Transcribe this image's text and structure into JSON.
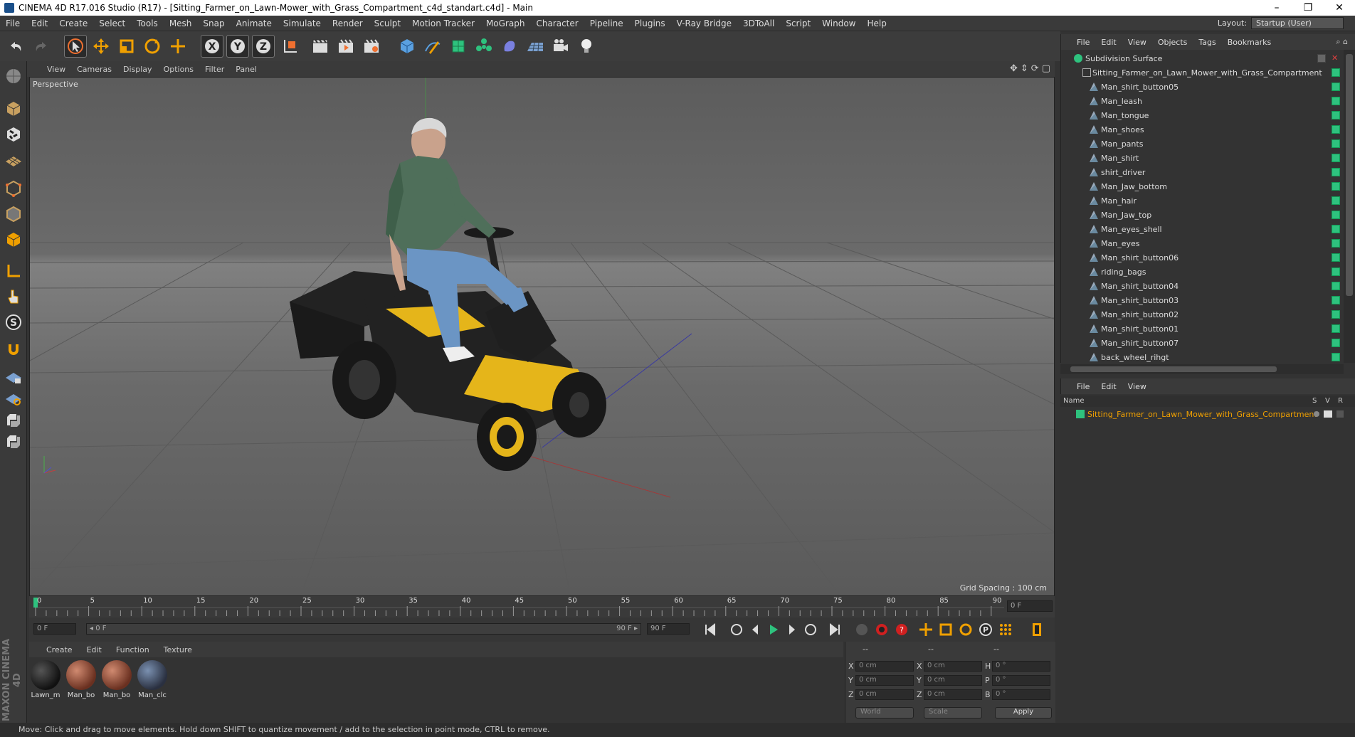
{
  "window": {
    "title": "CINEMA 4D R17.016 Studio (R17) - [Sitting_Farmer_on_Lawn-Mower_with_Grass_Compartment_c4d_standart.c4d] - Main",
    "controls": [
      "–",
      "❐",
      "✕"
    ]
  },
  "menu": [
    "File",
    "Edit",
    "Create",
    "Select",
    "Tools",
    "Mesh",
    "Snap",
    "Animate",
    "Simulate",
    "Render",
    "Sculpt",
    "Motion Tracker",
    "MoGraph",
    "Character",
    "Pipeline",
    "Plugins",
    "V-Ray Bridge",
    "3DToAll",
    "Script",
    "Window",
    "Help"
  ],
  "layout": {
    "label": "Layout:",
    "value": "Startup (User)"
  },
  "viewport": {
    "menu": [
      "View",
      "Cameras",
      "Display",
      "Options",
      "Filter",
      "Panel"
    ],
    "camera_label": "Perspective",
    "grid_spacing": "Grid Spacing : 100 cm"
  },
  "timeline": {
    "ticks": [
      "0",
      "5",
      "10",
      "15",
      "20",
      "25",
      "30",
      "35",
      "40",
      "45",
      "50",
      "55",
      "60",
      "65",
      "70",
      "75",
      "80",
      "85",
      "90"
    ],
    "current_frame": "0 F",
    "start_field": "0 F",
    "range_start": "◂ 0 F",
    "range_end": "90 F ▸",
    "end_field": "90 F"
  },
  "material_manager": {
    "menu": [
      "Create",
      "Edit",
      "Function",
      "Texture"
    ],
    "materials": [
      {
        "label": "Lawn_m",
        "color": "#2a2a2a"
      },
      {
        "label": "Man_bo",
        "color": "#a0533d"
      },
      {
        "label": "Man_bo",
        "color": "#a0533d"
      },
      {
        "label": "Man_clc",
        "color": "#4a5d7a"
      }
    ]
  },
  "coordinates": {
    "headers": [
      "--",
      "--",
      "--"
    ],
    "rows": [
      {
        "a": "X",
        "av": "0 cm",
        "b": "X",
        "bv": "0 cm",
        "c": "H",
        "cv": "0 °"
      },
      {
        "a": "Y",
        "av": "0 cm",
        "b": "Y",
        "bv": "0 cm",
        "c": "P",
        "cv": "0 °"
      },
      {
        "a": "Z",
        "av": "0 cm",
        "b": "Z",
        "bv": "0 cm",
        "c": "B",
        "cv": "0 °"
      }
    ],
    "mode": "World",
    "size_mode": "Scale",
    "apply": "Apply"
  },
  "object_manager": {
    "menu": [
      "File",
      "Edit",
      "View",
      "Objects",
      "Tags",
      "Bookmarks"
    ],
    "root": "Subdivision Surface",
    "group": "Sitting_Farmer_on_Lawn_Mower_with_Grass_Compartment",
    "children": [
      "Man_shirt_button05",
      "Man_leash",
      "Man_tongue",
      "Man_shoes",
      "Man_pants",
      "Man_shirt",
      "shirt_driver",
      "Man_Jaw_bottom",
      "Man_hair",
      "Man_Jaw_top",
      "Man_eyes_shell",
      "Man_eyes",
      "Man_shirt_button06",
      "riding_bags",
      "Man_shirt_button04",
      "Man_shirt_button03",
      "Man_shirt_button02",
      "Man_shirt_button01",
      "Man_shirt_button07",
      "back_wheel_rihgt"
    ]
  },
  "attribute_manager": {
    "menu": [
      "File",
      "Edit",
      "View"
    ],
    "columns": {
      "name": "Name",
      "s": "S",
      "v": "V",
      "r": "R"
    },
    "layer": "Sitting_Farmer_on_Lawn_Mower_with_Grass_Compartment"
  },
  "status": "Move: Click and drag to move elements. Hold down SHIFT to quantize movement / add to the selection in point mode, CTRL to remove.",
  "brand": "MAXON CINEMA 4D",
  "colors": {
    "accent": "#f0a000",
    "tag": "#2ec27e",
    "bg": "#333333"
  }
}
